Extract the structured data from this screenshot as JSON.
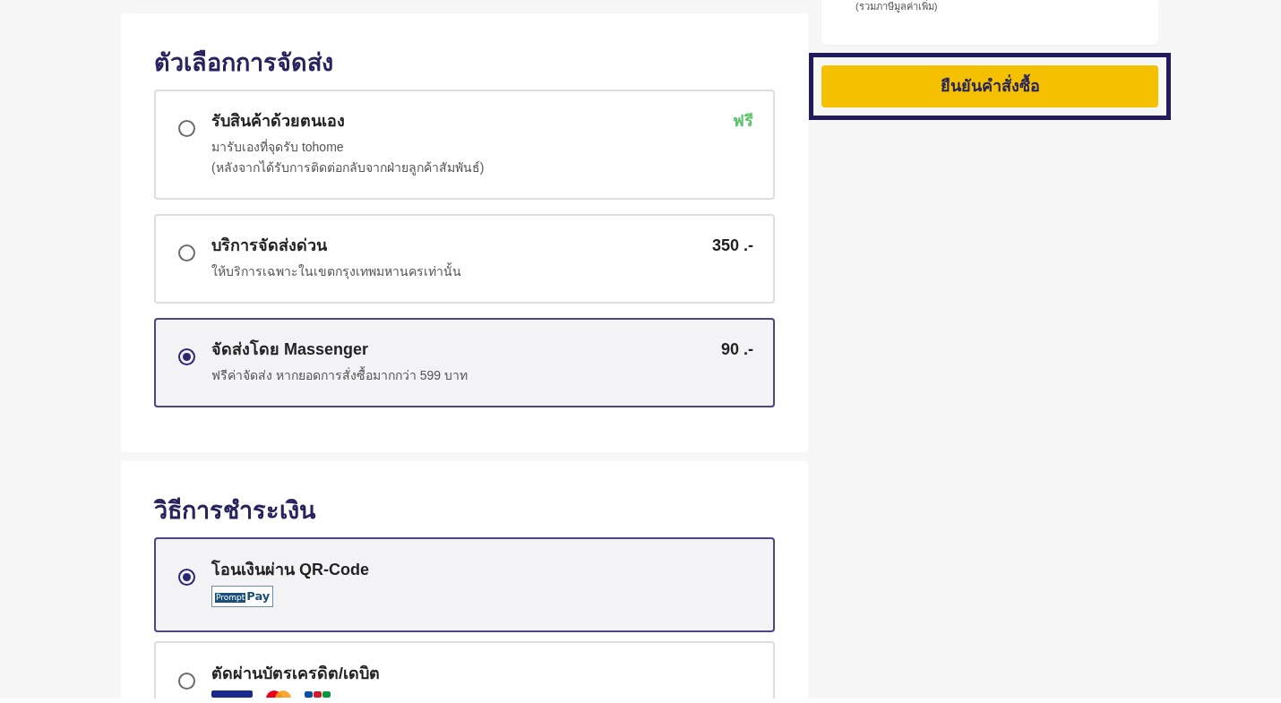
{
  "summary": {
    "tax_note": "(รวมภาษีมูลค่าเพิ่ม)"
  },
  "confirm_button": {
    "label": "ยืนยันคำสั่งซื้อ",
    "focused": true
  },
  "shipping": {
    "title": "ตัวเลือกการจัดส่ง",
    "options": [
      {
        "kind": "free",
        "title": "รับสินค้าด้วยตนเอง",
        "description": [
          "มารับเองที่จุดรับ tohome",
          "(หลังจากได้รับการติดต่อกลับจากฝ่ายลูกค้าสัมพันธ์)"
        ],
        "price": "ฟรี",
        "selected": false
      },
      {
        "kind": "paid",
        "title": "บริการจัดส่งด่วน",
        "description": [
          "ให้บริการเฉพาะในเขตกรุงเทพมหานครเท่านั้น"
        ],
        "price": "350 .-",
        "selected": false
      },
      {
        "kind": "paid",
        "title": "จัดส่งโดย Massenger",
        "description": [
          "ฟรีค่าจัดส่ง หากยอดการสั่งซื้อมากกว่า 599 บาท"
        ],
        "price": "90 .-",
        "selected": true
      }
    ]
  },
  "payment": {
    "title": "วิธีการชำระเงิน",
    "methods": [
      {
        "title": "โอนเงินผ่าน QR-Code",
        "logos": [
          {
            "kind": "promptpay",
            "text": [
              "Prompt",
              "Pay"
            ]
          }
        ],
        "selected": true
      },
      {
        "title": "ตัดผ่านบัตรเครดิต/เดบิต",
        "logos": [
          {
            "kind": "visa"
          },
          {
            "kind": "mastercard"
          },
          {
            "kind": "jcb"
          }
        ],
        "selected": false
      }
    ]
  }
}
